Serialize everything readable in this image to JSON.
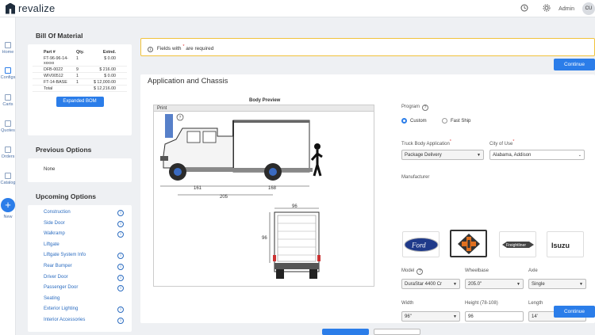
{
  "app": {
    "brand": "revalize",
    "user_role": "Admin",
    "user_initials": "CU"
  },
  "nav": [
    {
      "label": "Home",
      "icon": "home-icon"
    },
    {
      "label": "Configs",
      "icon": "configs-icon"
    },
    {
      "label": "Carts",
      "icon": "cart-icon"
    },
    {
      "label": "Quotes",
      "icon": "quotes-icon"
    },
    {
      "label": "Orders",
      "icon": "orders-icon"
    },
    {
      "label": "Catalog",
      "icon": "catalog-icon"
    },
    {
      "label": "New",
      "icon": "plus-icon"
    }
  ],
  "bom": {
    "title": "Bill Of Material",
    "headers": [
      "Part #",
      "Qty.",
      "Extnd."
    ],
    "rows": [
      {
        "part": "FT-96-96-14-xxxxx",
        "qty": "1",
        "ext": "$ 0.00"
      },
      {
        "part": "DFB-0022",
        "qty": "9",
        "ext": "$ 216.00"
      },
      {
        "part": "WIV00512",
        "qty": "1",
        "ext": "$ 0.00"
      },
      {
        "part": "FT-14-BASE",
        "qty": "1",
        "ext": "$ 12,000.00"
      },
      {
        "part": "Total",
        "qty": "",
        "ext": "$ 12,216.00"
      }
    ],
    "button": "Expanded BOM"
  },
  "previous": {
    "title": "Previous Options",
    "value": "None"
  },
  "upcoming": {
    "title": "Upcoming Options",
    "items": [
      {
        "label": "Construction",
        "info": true
      },
      {
        "label": "Side Door",
        "info": true
      },
      {
        "label": "Walkramp",
        "info": true
      },
      {
        "label": "Liftgate",
        "info": false
      },
      {
        "label": "Liftgate System Info",
        "info": true
      },
      {
        "label": "Rear Bumper",
        "info": true
      },
      {
        "label": "Driver Door",
        "info": true
      },
      {
        "label": "Passenger Door",
        "info": true
      },
      {
        "label": "Seating",
        "info": false
      },
      {
        "label": "Exterior Lighting",
        "info": true
      },
      {
        "label": "Interior Accessories",
        "info": true
      }
    ]
  },
  "notice": {
    "text_before": "Fields with",
    "asterisk": "*",
    "text_after": "are required"
  },
  "continue_label": "Continue",
  "section_title": "Application and Chassis",
  "preview": {
    "caption": "Body Preview",
    "print": "Print",
    "dims": {
      "side_front": "161",
      "side_rear": "168",
      "wheelbase": "205",
      "rear_width": "96",
      "rear_height": "96"
    }
  },
  "form": {
    "program_label": "Program",
    "program_options": [
      "Custom",
      "Fast Ship"
    ],
    "program_selected": "Custom",
    "truck_body_label": "Truck Body Application",
    "truck_body_value": "Package Delivery",
    "city_label": "City of Use",
    "city_value": "Alabama, Addison",
    "manufacturer_label": "Manufacturer",
    "manufacturers": [
      "Ford",
      "International",
      "Freightliner",
      "Isuzu"
    ],
    "model_label": "Model",
    "model_value": "DuraStar 4400 Cr",
    "wheelbase_label": "Wheelbase",
    "wheelbase_value": "205.0\"",
    "axle_label": "Axle",
    "axle_value": "Single",
    "width_label": "Width",
    "width_value": "96\"",
    "height_label": "Height (78-108)",
    "height_value": "96",
    "length_label": "Length",
    "length_value": "14'"
  },
  "colors": {
    "accent": "#2b7de9",
    "notice_border": "#f0c23b",
    "link": "#2b6cc0"
  }
}
